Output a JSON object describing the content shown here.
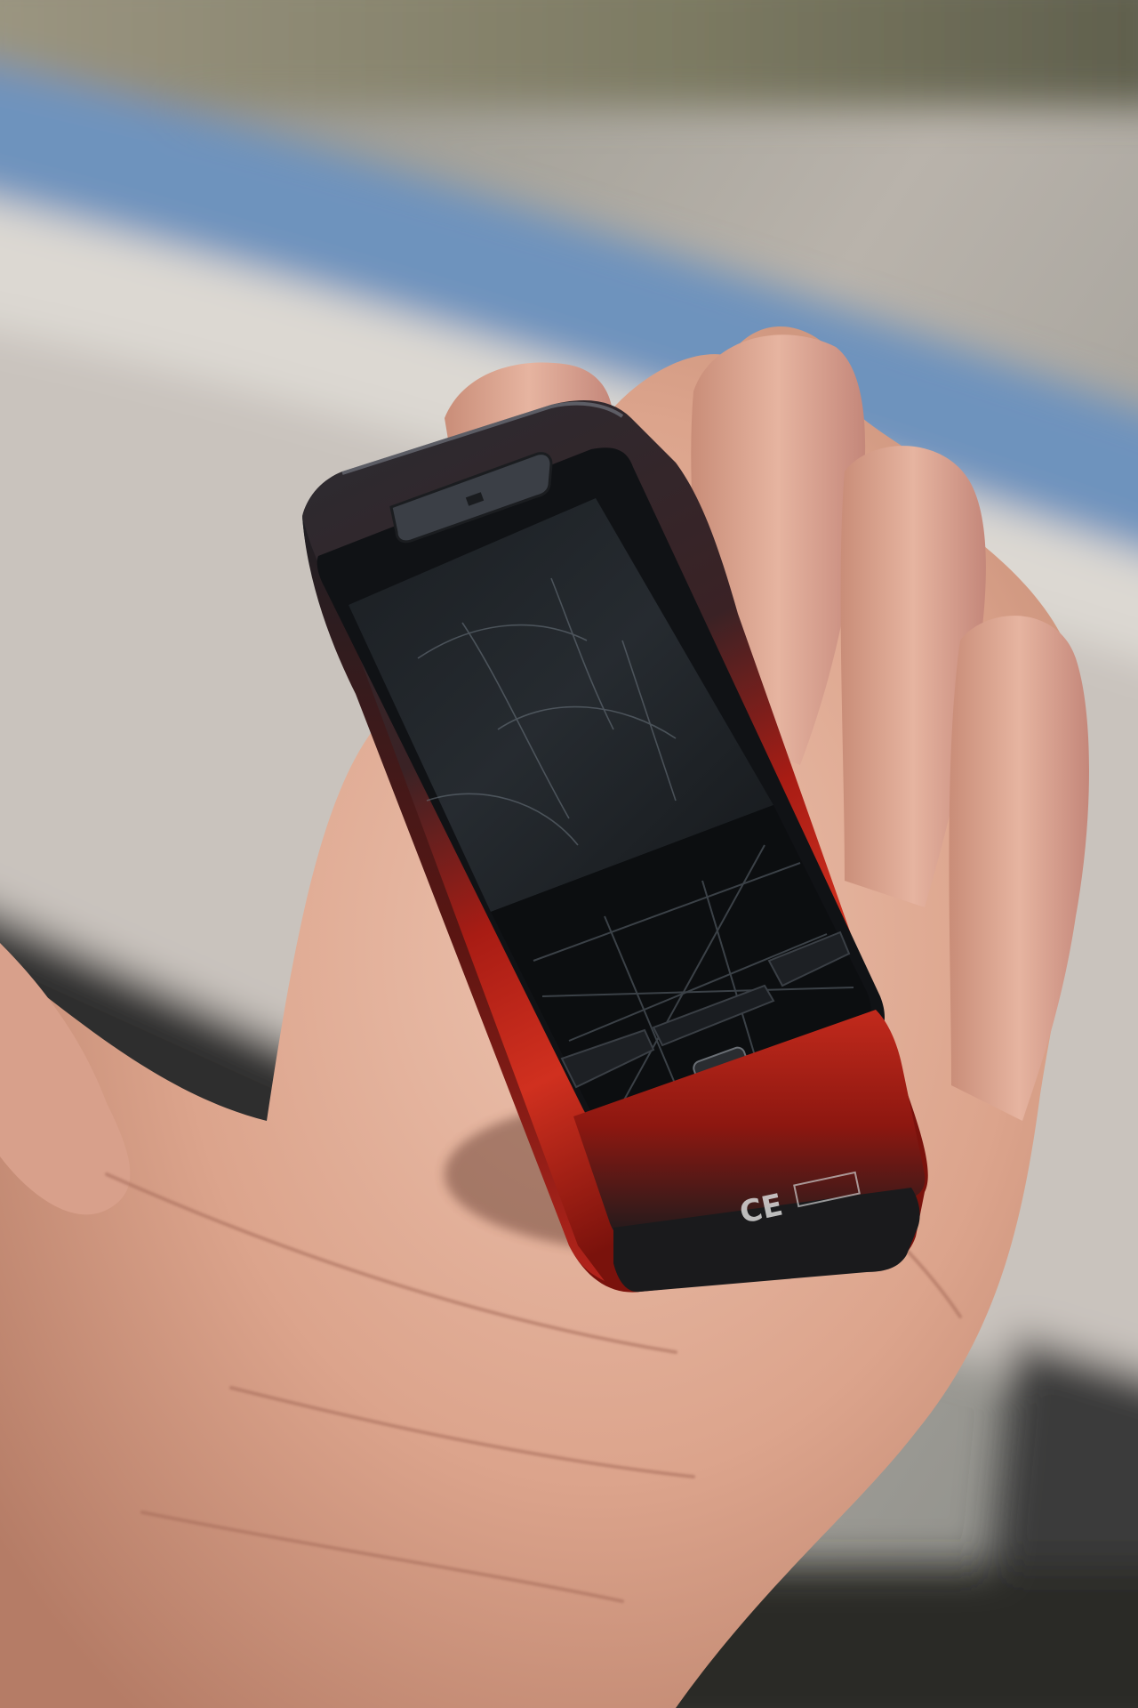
{
  "photo": {
    "subject": "phone-in-palm",
    "device": {
      "body_colors": {
        "top": "#26282c",
        "red": "#c3261a",
        "red_dark": "#6e0f0b",
        "base": "#1a1a1c"
      },
      "screen_color": "#131619",
      "keypad_color": "#0d0f11",
      "screen_state": "off"
    },
    "background": {
      "blue_stripe": "#6c8fb8",
      "wall": "#cdc7c0",
      "dark_edge": "#2b2c2c"
    },
    "skin_colors": {
      "light": "#e8b9a4",
      "mid": "#d49a84",
      "shadow": "#a8705e"
    },
    "marking_text": "CE"
  }
}
